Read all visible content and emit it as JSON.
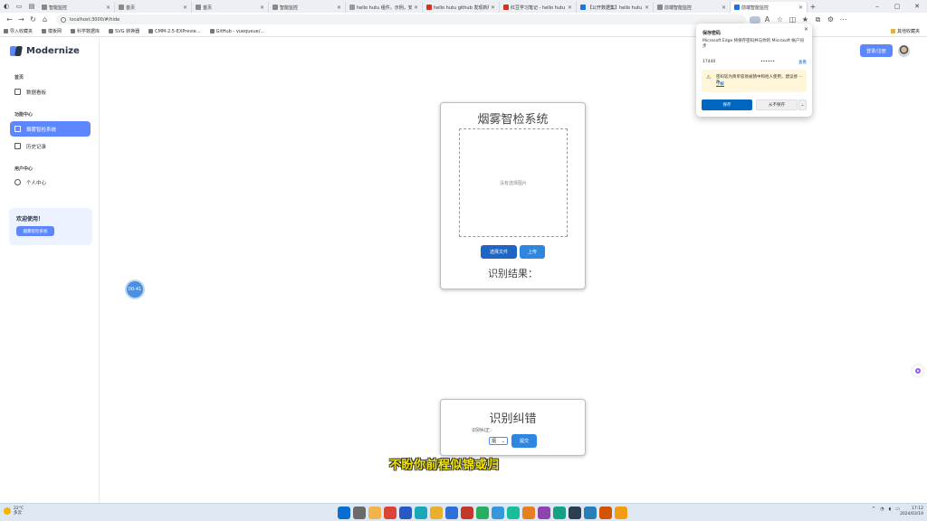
{
  "browser": {
    "tabs": [
      {
        "label": "智能监控",
        "active": false
      },
      {
        "label": "首页",
        "active": false
      },
      {
        "label": "首页",
        "active": false
      },
      {
        "label": "智能监控",
        "active": false
      },
      {
        "label": "hello hutu 组件，示例，安装",
        "active": false
      },
      {
        "label": "hello hutu github 发现新版",
        "active": false
      },
      {
        "label": "红豆学习笔记 - hello hutu",
        "active": false
      },
      {
        "label": "【公开数据集】hello hutu",
        "active": false
      },
      {
        "label": "前端智能监控",
        "active": false
      },
      {
        "label": "前端智能监控",
        "active": true
      }
    ],
    "url": "localhost:3000/#/hide",
    "bookmarks": [
      "导入收藏夹",
      "模板网",
      "科学数据库",
      "SVG 转换器",
      "CMM-2.5-EXPrevie...",
      "GitHub - vuequeue/..."
    ],
    "favorites_folder": "其他收藏夹"
  },
  "sidebar": {
    "logo": "Modernize",
    "sections": [
      {
        "label": "首页",
        "items": [
          {
            "label": "数据看板",
            "active": false
          }
        ]
      },
      {
        "label": "功能中心",
        "items": [
          {
            "label": "烟雾智检系统",
            "active": true
          },
          {
            "label": "历史记录",
            "active": false
          }
        ]
      },
      {
        "label": "用户中心",
        "items": [
          {
            "label": "个人中心",
            "active": false
          }
        ]
      }
    ],
    "promo": {
      "title": "欢迎使用！",
      "button": "烟雾智检系统"
    }
  },
  "header": {
    "login_button": "登录/注册"
  },
  "main": {
    "title": "烟雾智检系统",
    "upload_placeholder": "没有选择图片",
    "select_button": "选择文件",
    "upload_button": "上传",
    "result_label": "识别结果："
  },
  "correction": {
    "title": "识别纠错",
    "label": "识别纠正：",
    "select_value": "烟",
    "submit_button": "提交"
  },
  "bubble": "00:41",
  "subtitle": "不盼你前程似锦或归",
  "password_popup": {
    "title": "保存密码",
    "description": "Microsoft Edge 将保存密码并与你的 Microsoft 帐户同步",
    "username": "17440",
    "password": "••••••",
    "view_label": "查看",
    "warning": "密码较为简单容易被猜中和他人使用，建议修改。",
    "warning_link": "了解",
    "save_button": "保存",
    "never_button": "从不保存"
  },
  "taskbar": {
    "weather_temp": "22°C",
    "weather_desc": "多云",
    "time": "17:12",
    "date": "2024/03/19"
  },
  "colors": {
    "primary": "#5d87ff",
    "button_dark": "#1f66c4",
    "button": "#2e86de",
    "subtitle_fill": "#f2e600"
  }
}
